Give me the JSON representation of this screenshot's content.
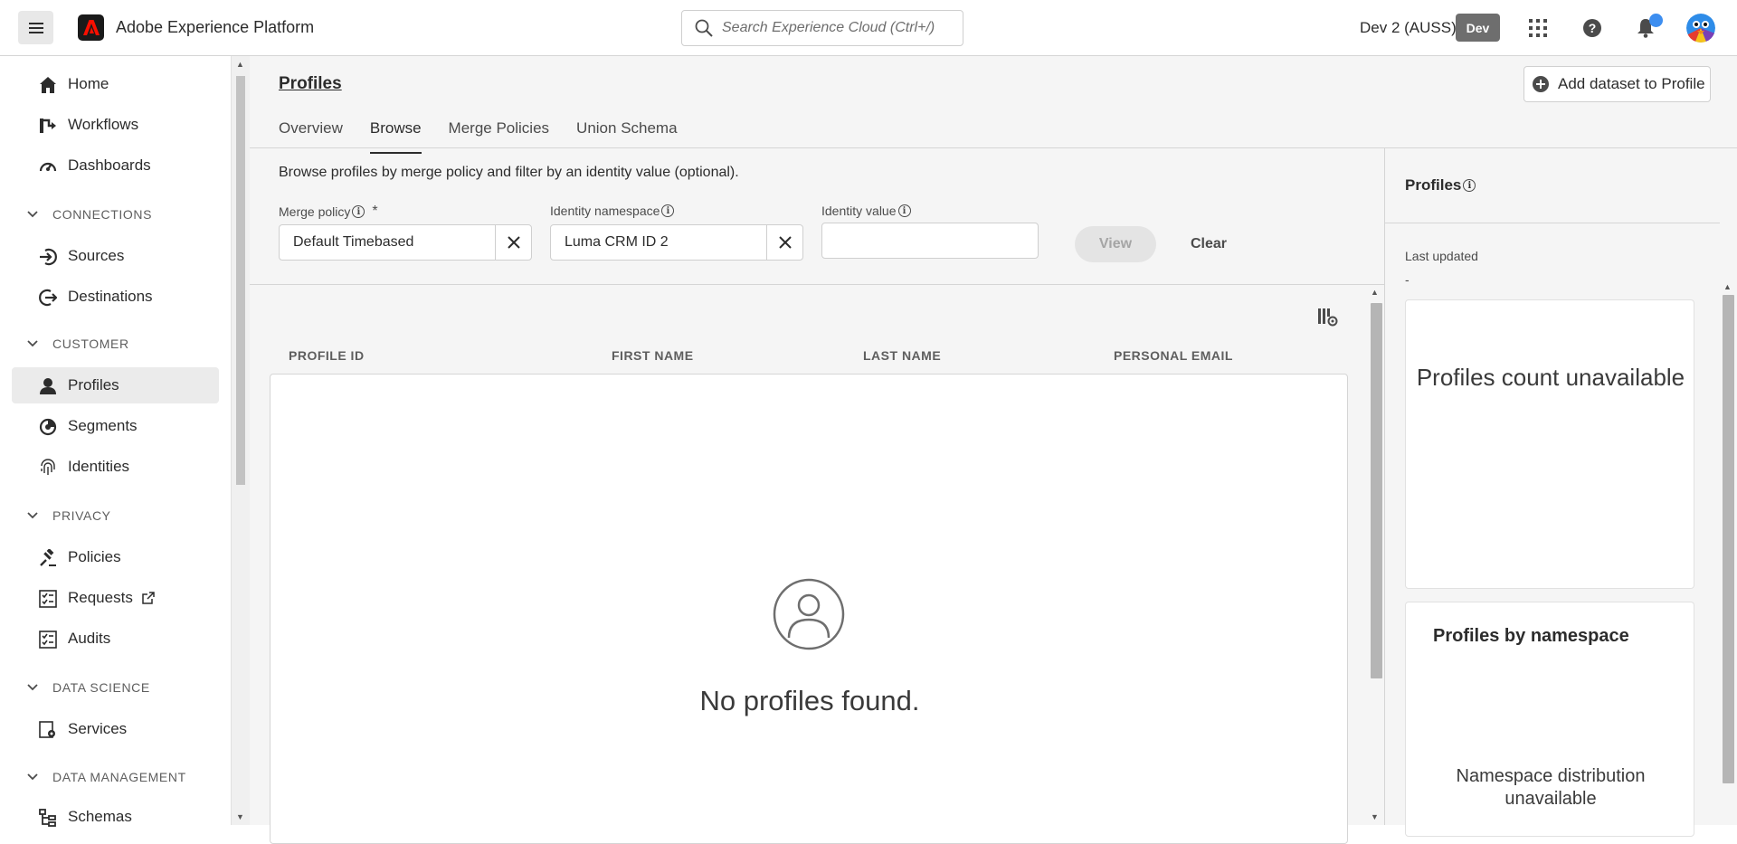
{
  "header": {
    "app_title": "Adobe Experience Platform",
    "search_placeholder": "Search Experience Cloud (Ctrl+/)",
    "org_name": "Dev 2 (AUSS)",
    "sandbox_badge": "Dev"
  },
  "sidebar": {
    "items": [
      {
        "label": "Home",
        "icon": "home-icon"
      },
      {
        "label": "Workflows",
        "icon": "workflow-icon"
      },
      {
        "label": "Dashboards",
        "icon": "dashboard-icon"
      },
      {
        "label": "Sources",
        "icon": "sources-icon"
      },
      {
        "label": "Destinations",
        "icon": "destinations-icon"
      },
      {
        "label": "Profiles",
        "icon": "user-icon",
        "active": true
      },
      {
        "label": "Segments",
        "icon": "segments-icon"
      },
      {
        "label": "Identities",
        "icon": "fingerprint-icon"
      },
      {
        "label": "Policies",
        "icon": "gavel-icon"
      },
      {
        "label": "Requests",
        "icon": "checklist-icon",
        "external": true
      },
      {
        "label": "Audits",
        "icon": "checklist-icon"
      },
      {
        "label": "Services",
        "icon": "services-icon"
      },
      {
        "label": "Schemas",
        "icon": "schema-icon"
      }
    ],
    "sections": [
      "CONNECTIONS",
      "CUSTOMER",
      "PRIVACY",
      "DATA SCIENCE",
      "DATA MANAGEMENT"
    ]
  },
  "main": {
    "page_title": "Profiles",
    "add_dataset_label": "Add dataset to Profile",
    "tabs": [
      {
        "label": "Overview"
      },
      {
        "label": "Browse",
        "active": true
      },
      {
        "label": "Merge Policies"
      },
      {
        "label": "Union Schema"
      }
    ],
    "description": "Browse profiles by merge policy and filter by an identity value (optional).",
    "filters": {
      "merge_policy_label": "Merge policy",
      "merge_policy_value": "Default Timebased",
      "required_mark": "*",
      "namespace_label": "Identity namespace",
      "namespace_value": "Luma CRM ID 2",
      "identity_value_label": "Identity value",
      "identity_value": "",
      "view_label": "View",
      "clear_label": "Clear"
    },
    "table": {
      "columns": [
        "PROFILE ID",
        "FIRST NAME",
        "LAST NAME",
        "PERSONAL EMAIL"
      ],
      "rows": [],
      "empty_message": "No profiles found."
    }
  },
  "rail": {
    "title": "Profiles",
    "last_updated_label": "Last updated",
    "last_updated_value": "-",
    "count_message": "Profiles count unavailable",
    "namespace_card_title": "Profiles by namespace",
    "namespace_message_line1": "Namespace distribution",
    "namespace_message_line2": "unavailable"
  },
  "colors": {
    "notification_dot": "#3d8ef0",
    "sandbox_badge_bg": "#6e6e6e",
    "active_nav_bg": "#ebebeb"
  }
}
